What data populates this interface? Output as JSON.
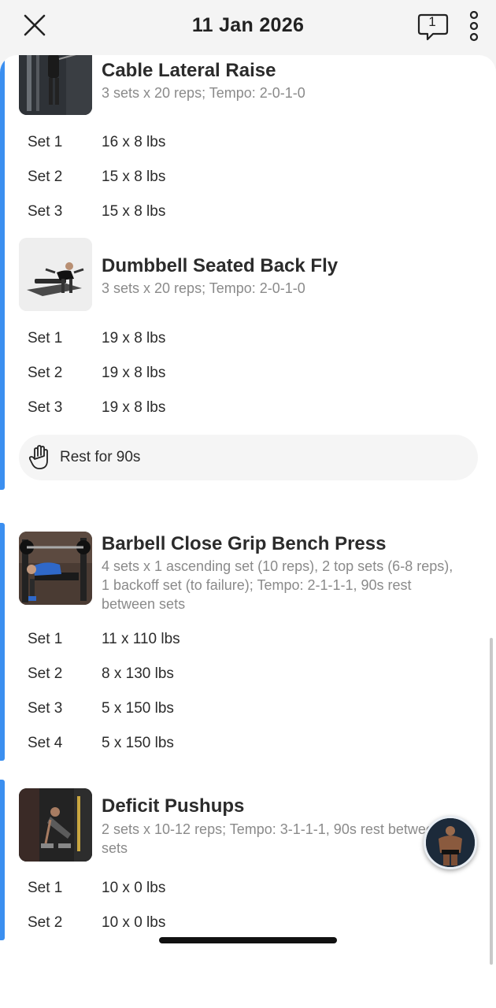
{
  "header": {
    "title": "11 Jan 2026",
    "comment_count": "1",
    "close_icon": "close-icon",
    "comment_icon": "comment-icon",
    "more_icon": "more-vertical-icon"
  },
  "exercises": [
    {
      "name": "Cable Lateral Raise",
      "description": "3 sets x 20 reps; Tempo: 2-0-1-0",
      "sets": [
        {
          "label": "Set 1",
          "value": "16 x 8 lbs"
        },
        {
          "label": "Set 2",
          "value": "15 x 8 lbs"
        },
        {
          "label": "Set 3",
          "value": "15 x 8 lbs"
        }
      ]
    },
    {
      "name": "Dumbbell Seated Back Fly",
      "description": "3 sets x 20 reps; Tempo: 2-0-1-0",
      "sets": [
        {
          "label": "Set 1",
          "value": "19 x 8 lbs"
        },
        {
          "label": "Set 2",
          "value": "19 x 8 lbs"
        },
        {
          "label": "Set 3",
          "value": "19 x 8 lbs"
        }
      ]
    },
    {
      "name": "Barbell Close Grip Bench Press",
      "description": "4 sets x 1 ascending set (10 reps), 2 top sets (6-8 reps), 1 backoff set (to failure); Tempo: 2-1-1-1, 90s rest between sets",
      "sets": [
        {
          "label": "Set 1",
          "value": "11 x 110 lbs"
        },
        {
          "label": "Set 2",
          "value": "8 x 130 lbs"
        },
        {
          "label": "Set 3",
          "value": "5 x 150 lbs"
        },
        {
          "label": "Set 4",
          "value": "5 x 150 lbs"
        }
      ]
    },
    {
      "name": "Deficit Pushups",
      "description": "2 sets x 10-12 reps; Tempo: 3-1-1-1, 90s rest between sets",
      "sets": [
        {
          "label": "Set 1",
          "value": "10 x 0 lbs"
        },
        {
          "label": "Set 2",
          "value": "10 x 0 lbs"
        }
      ]
    }
  ],
  "rest": {
    "label": "Rest for 90s",
    "icon": "hand-icon"
  },
  "colors": {
    "accent": "#3b8ff0",
    "muted_text": "#8a8a8a",
    "background": "#f4f4f4",
    "card": "#ffffff"
  }
}
